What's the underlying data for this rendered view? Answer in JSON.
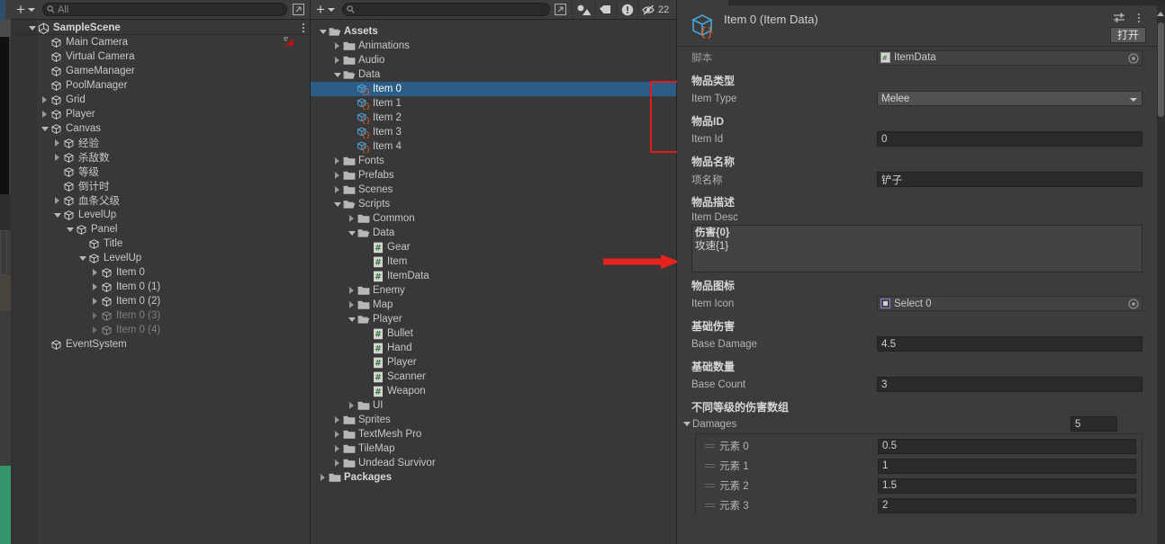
{
  "hierarchy": {
    "toolbar": {
      "add_label": "+",
      "search_placeholder": "All",
      "search_value": "",
      "expand_icon": "open-in-new-icon"
    },
    "items": [
      {
        "label": "SampleScene",
        "depth": 0,
        "icon": "unity-scene-icon",
        "arrow": "down",
        "bold": true,
        "dim": false,
        "kebab": true
      },
      {
        "label": "Main Camera",
        "depth": 1,
        "icon": "gameobject-icon",
        "arrow": "none",
        "bold": false,
        "dim": false,
        "badge": "camera-preview-icon"
      },
      {
        "label": "Virtual Camera",
        "depth": 1,
        "icon": "gameobject-icon",
        "arrow": "none",
        "bold": false,
        "dim": false
      },
      {
        "label": "GameManager",
        "depth": 1,
        "icon": "gameobject-icon",
        "arrow": "none",
        "bold": false,
        "dim": false
      },
      {
        "label": "PoolManager",
        "depth": 1,
        "icon": "gameobject-icon",
        "arrow": "none",
        "bold": false,
        "dim": false
      },
      {
        "label": "Grid",
        "depth": 1,
        "icon": "gameobject-icon",
        "arrow": "right",
        "bold": false,
        "dim": false
      },
      {
        "label": "Player",
        "depth": 1,
        "icon": "gameobject-icon",
        "arrow": "right",
        "bold": false,
        "dim": false
      },
      {
        "label": "Canvas",
        "depth": 1,
        "icon": "gameobject-icon",
        "arrow": "down",
        "bold": false,
        "dim": false
      },
      {
        "label": "经验",
        "depth": 2,
        "icon": "gameobject-icon",
        "arrow": "right",
        "bold": false,
        "dim": false
      },
      {
        "label": "杀敌数",
        "depth": 2,
        "icon": "gameobject-icon",
        "arrow": "right",
        "bold": false,
        "dim": false
      },
      {
        "label": "等级",
        "depth": 2,
        "icon": "gameobject-icon",
        "arrow": "none",
        "bold": false,
        "dim": false
      },
      {
        "label": "倒计时",
        "depth": 2,
        "icon": "gameobject-icon",
        "arrow": "none",
        "bold": false,
        "dim": false
      },
      {
        "label": "血条父级",
        "depth": 2,
        "icon": "gameobject-icon",
        "arrow": "right",
        "bold": false,
        "dim": false
      },
      {
        "label": "LevelUp",
        "depth": 2,
        "icon": "gameobject-icon",
        "arrow": "down",
        "bold": false,
        "dim": false
      },
      {
        "label": "Panel",
        "depth": 3,
        "icon": "gameobject-icon",
        "arrow": "down",
        "bold": false,
        "dim": false
      },
      {
        "label": "Title",
        "depth": 4,
        "icon": "gameobject-icon",
        "arrow": "none",
        "bold": false,
        "dim": false
      },
      {
        "label": "LevelUp",
        "depth": 4,
        "icon": "gameobject-icon",
        "arrow": "down",
        "bold": false,
        "dim": false
      },
      {
        "label": "Item 0",
        "depth": 5,
        "icon": "gameobject-icon",
        "arrow": "right",
        "bold": false,
        "dim": false
      },
      {
        "label": "Item 0 (1)",
        "depth": 5,
        "icon": "gameobject-icon",
        "arrow": "right",
        "bold": false,
        "dim": false
      },
      {
        "label": "Item 0 (2)",
        "depth": 5,
        "icon": "gameobject-icon",
        "arrow": "right",
        "bold": false,
        "dim": false
      },
      {
        "label": "Item 0 (3)",
        "depth": 5,
        "icon": "gameobject-icon",
        "arrow": "right",
        "bold": false,
        "dim": true
      },
      {
        "label": "Item 0 (4)",
        "depth": 5,
        "icon": "gameobject-icon",
        "arrow": "right",
        "bold": false,
        "dim": true
      },
      {
        "label": "EventSystem",
        "depth": 1,
        "icon": "gameobject-icon",
        "arrow": "none",
        "bold": false,
        "dim": false
      }
    ]
  },
  "project": {
    "toolbar": {
      "add_label": "+",
      "search_placeholder": "",
      "search_value": "",
      "expand_icon": "open-in-new-icon",
      "filter_type_icon": "filter-by-type-icon",
      "filter_label_icon": "filter-by-label-icon",
      "warning_icon": "alert-circle-icon",
      "hidden_icon": "eye-off-icon",
      "hidden_count": "22"
    },
    "items": [
      {
        "label": "Assets",
        "depth": 0,
        "icon": "folder-open-icon",
        "arrow": "down",
        "bold": true,
        "selected": false
      },
      {
        "label": "Animations",
        "depth": 1,
        "icon": "folder-icon",
        "arrow": "right",
        "bold": false,
        "selected": false
      },
      {
        "label": "Audio",
        "depth": 1,
        "icon": "folder-icon",
        "arrow": "right",
        "bold": false,
        "selected": false
      },
      {
        "label": "Data",
        "depth": 1,
        "icon": "folder-open-icon",
        "arrow": "down",
        "bold": false,
        "selected": false
      },
      {
        "label": "Item 0",
        "depth": 2,
        "icon": "scriptable-object-icon",
        "arrow": "none",
        "bold": false,
        "selected": true
      },
      {
        "label": "Item 1",
        "depth": 2,
        "icon": "scriptable-object-icon",
        "arrow": "none",
        "bold": false,
        "selected": false
      },
      {
        "label": "Item 2",
        "depth": 2,
        "icon": "scriptable-object-icon",
        "arrow": "none",
        "bold": false,
        "selected": false
      },
      {
        "label": "Item 3",
        "depth": 2,
        "icon": "scriptable-object-icon",
        "arrow": "none",
        "bold": false,
        "selected": false
      },
      {
        "label": "Item 4",
        "depth": 2,
        "icon": "scriptable-object-icon",
        "arrow": "none",
        "bold": false,
        "selected": false
      },
      {
        "label": "Fonts",
        "depth": 1,
        "icon": "folder-icon",
        "arrow": "right",
        "bold": false,
        "selected": false
      },
      {
        "label": "Prefabs",
        "depth": 1,
        "icon": "folder-icon",
        "arrow": "right",
        "bold": false,
        "selected": false
      },
      {
        "label": "Scenes",
        "depth": 1,
        "icon": "folder-icon",
        "arrow": "right",
        "bold": false,
        "selected": false
      },
      {
        "label": "Scripts",
        "depth": 1,
        "icon": "folder-open-icon",
        "arrow": "down",
        "bold": false,
        "selected": false
      },
      {
        "label": "Common",
        "depth": 2,
        "icon": "folder-icon",
        "arrow": "right",
        "bold": false,
        "selected": false
      },
      {
        "label": "Data",
        "depth": 2,
        "icon": "folder-open-icon",
        "arrow": "down",
        "bold": false,
        "selected": false
      },
      {
        "label": "Gear",
        "depth": 3,
        "icon": "csharp-script-icon",
        "arrow": "none",
        "bold": false,
        "selected": false
      },
      {
        "label": "Item",
        "depth": 3,
        "icon": "csharp-script-icon",
        "arrow": "none",
        "bold": false,
        "selected": false
      },
      {
        "label": "ItemData",
        "depth": 3,
        "icon": "csharp-script-icon",
        "arrow": "none",
        "bold": false,
        "selected": false
      },
      {
        "label": "Enemy",
        "depth": 2,
        "icon": "folder-icon",
        "arrow": "right",
        "bold": false,
        "selected": false
      },
      {
        "label": "Map",
        "depth": 2,
        "icon": "folder-icon",
        "arrow": "right",
        "bold": false,
        "selected": false
      },
      {
        "label": "Player",
        "depth": 2,
        "icon": "folder-open-icon",
        "arrow": "down",
        "bold": false,
        "selected": false
      },
      {
        "label": "Bullet",
        "depth": 3,
        "icon": "csharp-script-icon",
        "arrow": "none",
        "bold": false,
        "selected": false
      },
      {
        "label": "Hand",
        "depth": 3,
        "icon": "csharp-script-icon",
        "arrow": "none",
        "bold": false,
        "selected": false
      },
      {
        "label": "Player",
        "depth": 3,
        "icon": "csharp-script-icon",
        "arrow": "none",
        "bold": false,
        "selected": false
      },
      {
        "label": "Scanner",
        "depth": 3,
        "icon": "csharp-script-icon",
        "arrow": "none",
        "bold": false,
        "selected": false
      },
      {
        "label": "Weapon",
        "depth": 3,
        "icon": "csharp-script-icon",
        "arrow": "none",
        "bold": false,
        "selected": false
      },
      {
        "label": "UI",
        "depth": 2,
        "icon": "folder-icon",
        "arrow": "right",
        "bold": false,
        "selected": false
      },
      {
        "label": "Sprites",
        "depth": 1,
        "icon": "folder-icon",
        "arrow": "right",
        "bold": false,
        "selected": false
      },
      {
        "label": "TextMesh Pro",
        "depth": 1,
        "icon": "folder-icon",
        "arrow": "right",
        "bold": false,
        "selected": false
      },
      {
        "label": "TileMap",
        "depth": 1,
        "icon": "folder-icon",
        "arrow": "right",
        "bold": false,
        "selected": false
      },
      {
        "label": "Undead Survivor",
        "depth": 1,
        "icon": "folder-icon",
        "arrow": "right",
        "bold": false,
        "selected": false
      },
      {
        "label": "Packages",
        "depth": 0,
        "icon": "folder-icon",
        "arrow": "right",
        "bold": true,
        "selected": false
      }
    ]
  },
  "inspector": {
    "title": "Item 0 (Item Data)",
    "object_icon": "scriptable-object-icon",
    "settings_icon": "preset-settings-icon",
    "kebab_icon": "more-options-icon",
    "open_button": "打开",
    "script": {
      "label": "脚本",
      "value": "ItemData",
      "icon": "csharp-script-icon",
      "picker_icon": "object-picker-icon"
    },
    "fields": [
      {
        "cn": "物品类型",
        "en": "Item Type",
        "value": "Melee",
        "kind": "dropdown"
      },
      {
        "cn": "物品ID",
        "en": "Item Id",
        "value": "0",
        "kind": "text"
      },
      {
        "cn": "物品名称",
        "en": "项名称",
        "value": "铲子",
        "kind": "text"
      }
    ],
    "desc": {
      "cn": "物品描述",
      "en": "Item Desc",
      "line1": "伤害{0}",
      "line2": "攻速{1}"
    },
    "icon_field": {
      "cn": "物品图标",
      "en": "Item Icon",
      "value": "Select 0",
      "sprite_icon": "sprite-icon",
      "picker_icon": "object-picker-icon"
    },
    "fields2": [
      {
        "cn": "基础伤害",
        "en": "Base Damage",
        "value": "4.5",
        "kind": "text"
      },
      {
        "cn": "基础数量",
        "en": "Base Count",
        "value": "3",
        "kind": "text"
      }
    ],
    "array": {
      "cn": "不同等级的伤害数组",
      "en": "Damages",
      "size": "5",
      "elements": [
        {
          "name": "元素 0",
          "value": "0.5"
        },
        {
          "name": "元素 1",
          "value": "1"
        },
        {
          "name": "元素 2",
          "value": "1.5"
        },
        {
          "name": "元素 3",
          "value": "2"
        }
      ]
    }
  },
  "annotations": {
    "red_box_target": "project-item-list",
    "red_arrow_target": "inspector-panel",
    "color": "#e01b1b"
  }
}
